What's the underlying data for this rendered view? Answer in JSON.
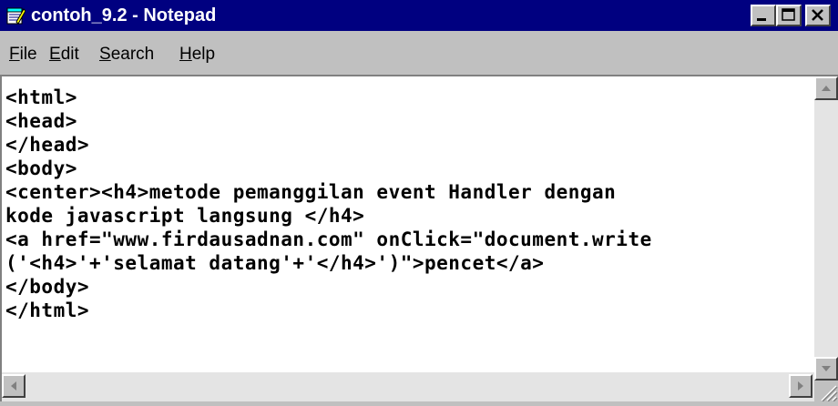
{
  "window": {
    "title": "contoh_9.2 - Notepad",
    "icon": "notepad-icon",
    "controls": [
      "minimize-icon",
      "maximize-icon",
      "close-icon"
    ]
  },
  "menu": {
    "items": [
      {
        "label": "File",
        "accel": "F"
      },
      {
        "label": "Edit",
        "accel": "E"
      },
      {
        "label": "Search",
        "accel": "S"
      },
      {
        "label": "Help",
        "accel": "H"
      }
    ]
  },
  "editor": {
    "lines": [
      "<html>",
      "<head>",
      "</head>",
      "<body>",
      "<center><h4>metode pemanggilan event Handler dengan",
      "kode javascript langsung </h4>",
      "<a href=\"www.firdausadnan.com\" onClick=\"document.write",
      "('<h4>'+'selamat datang'+'</h4>')\">pencet</a>",
      "</body>",
      "</html>"
    ]
  },
  "colors": {
    "titlebar": "#000080",
    "chrome": "#c0c0c0",
    "editor_bg": "#ffffff",
    "text": "#000000"
  }
}
